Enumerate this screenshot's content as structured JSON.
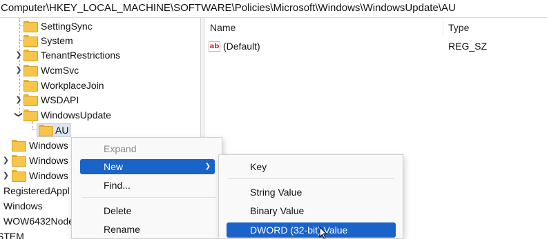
{
  "address": {
    "path": "Computer\\HKEY_LOCAL_MACHINE\\SOFTWARE\\Policies\\Microsoft\\Windows\\WindowsUpdate\\AU"
  },
  "tree": {
    "items": [
      {
        "label": "SettingSync",
        "expandable": false
      },
      {
        "label": "System",
        "expandable": false
      },
      {
        "label": "TenantRestrictions",
        "expandable": true
      },
      {
        "label": "WcmSvc",
        "expandable": true
      },
      {
        "label": "WorkplaceJoin",
        "expandable": false
      },
      {
        "label": "WSDAPI",
        "expandable": true
      },
      {
        "label": "WindowsUpdate",
        "expandable": true,
        "expanded": true
      },
      {
        "label": "AU",
        "selected": true
      }
    ],
    "partial_items": [
      {
        "label": "Windows"
      },
      {
        "label": "Windows"
      },
      {
        "label": "Windows"
      },
      {
        "label": "RegisteredAppl"
      },
      {
        "label": "Windows"
      },
      {
        "label": "WOW6432Node"
      },
      {
        "label": "STEM"
      }
    ]
  },
  "list": {
    "columns": {
      "name": "Name",
      "type": "Type"
    },
    "rows": [
      {
        "name": "(Default)",
        "type": "REG_SZ",
        "icon": "ab-string-icon"
      }
    ]
  },
  "context_menu": {
    "items": [
      {
        "label": "Expand",
        "disabled": true
      },
      {
        "label": "New",
        "highlighted": true,
        "has_submenu": true
      },
      {
        "label": "Find..."
      },
      {
        "label": "Delete"
      },
      {
        "label": "Rename"
      }
    ]
  },
  "new_submenu": {
    "items": [
      {
        "label": "Key"
      },
      {
        "label": "String Value"
      },
      {
        "label": "Binary Value"
      },
      {
        "label": "DWORD (32-bit) Value",
        "highlighted": true
      }
    ]
  },
  "colors": {
    "highlight": "#1a63c9",
    "folder": "#f6c54a",
    "selected_node": "#dde4ef"
  }
}
